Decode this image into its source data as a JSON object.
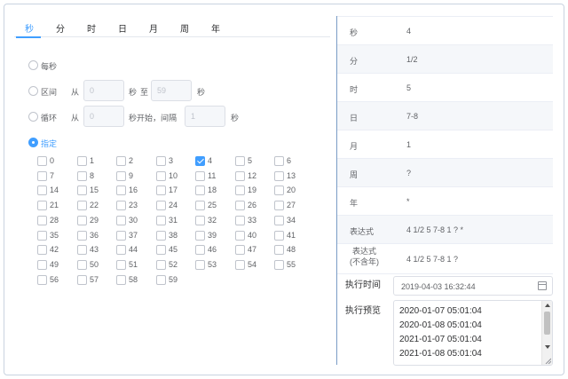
{
  "tabs": [
    "秒",
    "分",
    "时",
    "日",
    "月",
    "周",
    "年"
  ],
  "options": {
    "every": "每秒",
    "range": {
      "label": "区间",
      "from": "从",
      "from_value": "0",
      "unit": "秒",
      "to": "至",
      "to_value": "59",
      "unit2": "秒"
    },
    "cycle": {
      "label": "循环",
      "from": "从",
      "from_value": "0",
      "start": "秒开始，间隔",
      "step_value": "1",
      "unit": "秒"
    },
    "specify": "指定"
  },
  "checkboxes": [
    "0",
    "1",
    "2",
    "3",
    "4",
    "5",
    "6",
    "7",
    "8",
    "9",
    "10",
    "11",
    "12",
    "13",
    "14",
    "15",
    "16",
    "17",
    "18",
    "19",
    "20",
    "21",
    "22",
    "23",
    "24",
    "25",
    "26",
    "27",
    "28",
    "29",
    "30",
    "31",
    "32",
    "33",
    "34",
    "35",
    "36",
    "37",
    "38",
    "39",
    "40",
    "41",
    "42",
    "43",
    "44",
    "45",
    "46",
    "47",
    "48",
    "49",
    "50",
    "51",
    "52",
    "53",
    "54",
    "55",
    "56",
    "57",
    "58",
    "59"
  ],
  "checked": [
    "4"
  ],
  "summary": [
    {
      "key": "秒",
      "value": "4"
    },
    {
      "key": "分",
      "value": "1/2"
    },
    {
      "key": "时",
      "value": "5"
    },
    {
      "key": "日",
      "value": "7-8"
    },
    {
      "key": "月",
      "value": "1"
    },
    {
      "key": "周",
      "value": "?"
    },
    {
      "key": "年",
      "value": "*"
    },
    {
      "key": "表达式",
      "value": "4 1/2 5 7-8 1 ? *"
    },
    {
      "key": "表达式\n(不含年)",
      "value": "4 1/2 5 7-8 1 ?"
    }
  ],
  "exec_time": {
    "label": "执行时间",
    "value": "2019-04-03 16:32:44"
  },
  "exec_preview": {
    "label": "执行预览",
    "lines": [
      "2020-01-07 05:01:04",
      "2020-01-08 05:01:04",
      "2021-01-07 05:01:04",
      "2021-01-08 05:01:04"
    ]
  },
  "colors": {
    "accent": "#409eff",
    "border": "#dcdfe6"
  }
}
